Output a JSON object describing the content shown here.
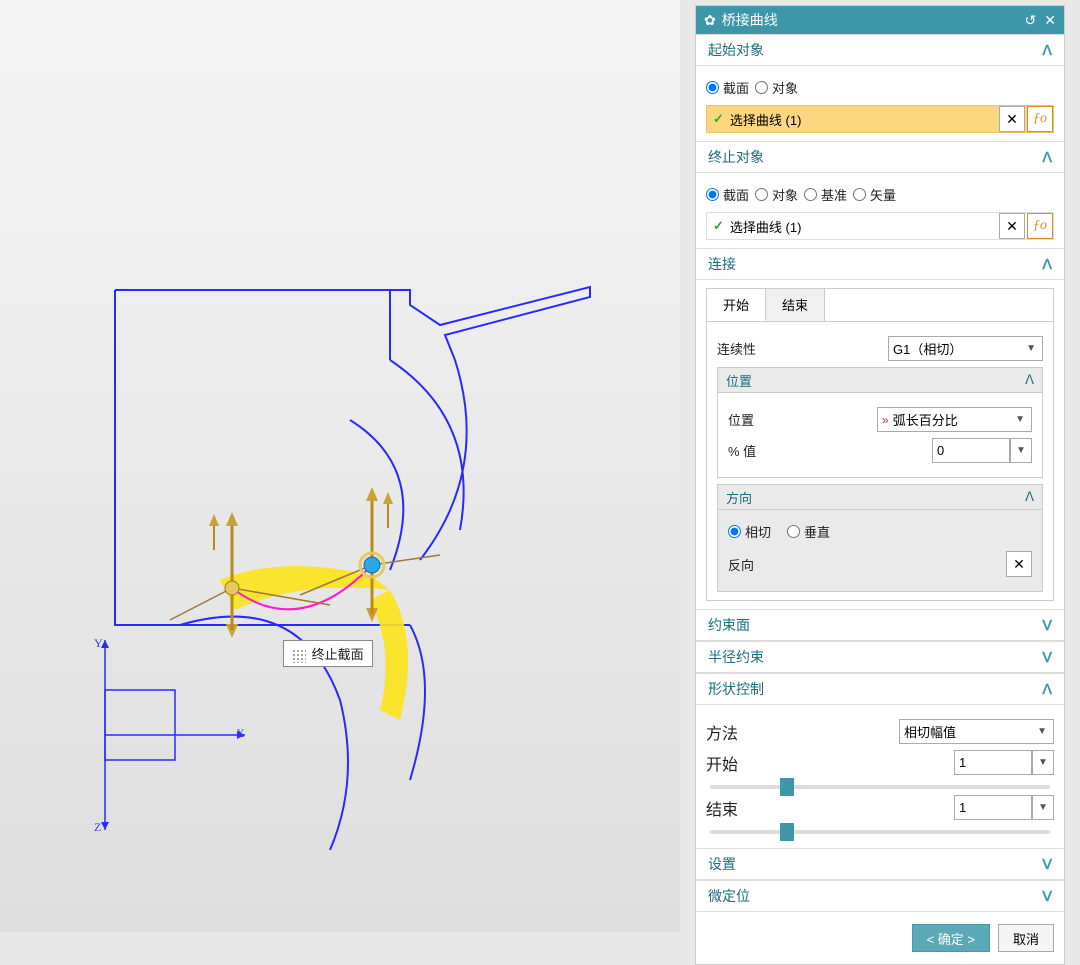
{
  "panel": {
    "title": "桥接曲线",
    "sections": {
      "start": {
        "title": "起始对象",
        "radios": {
          "section": "截面",
          "object": "对象"
        },
        "select_label": "选择曲线 (1)"
      },
      "end": {
        "title": "终止对象",
        "radios": {
          "section": "截面",
          "object": "对象",
          "datum": "基准",
          "vector": "矢量"
        },
        "select_label": "选择曲线 (1)"
      },
      "connect": {
        "title": "连接",
        "tabs": {
          "start": "开始",
          "end": "结束"
        },
        "continuity_label": "连续性",
        "continuity_value": "G1（相切）",
        "position_header": "位置",
        "position_label": "位置",
        "position_value": "弧长百分比",
        "percent_label": "% 值",
        "percent_value": "0",
        "direction_header": "方向",
        "direction_radios": {
          "tangent": "相切",
          "perp": "垂直"
        },
        "reverse_label": "反向"
      },
      "constraint_face": {
        "title": "约束面"
      },
      "radius_constraint": {
        "title": "半径约束"
      },
      "shape_control": {
        "title": "形状控制",
        "method_label": "方法",
        "method_value": "相切幅值",
        "start_label": "开始",
        "start_value": "1",
        "end_label": "结束",
        "end_value": "1"
      },
      "settings": {
        "title": "设置"
      },
      "micro": {
        "title": "微定位"
      }
    },
    "buttons": {
      "ok": "< 确定 >",
      "cancel": "取消"
    }
  },
  "viewport": {
    "tooltip": "终止截面",
    "axes": {
      "x": "X",
      "y": "Y",
      "z": "Z"
    }
  }
}
